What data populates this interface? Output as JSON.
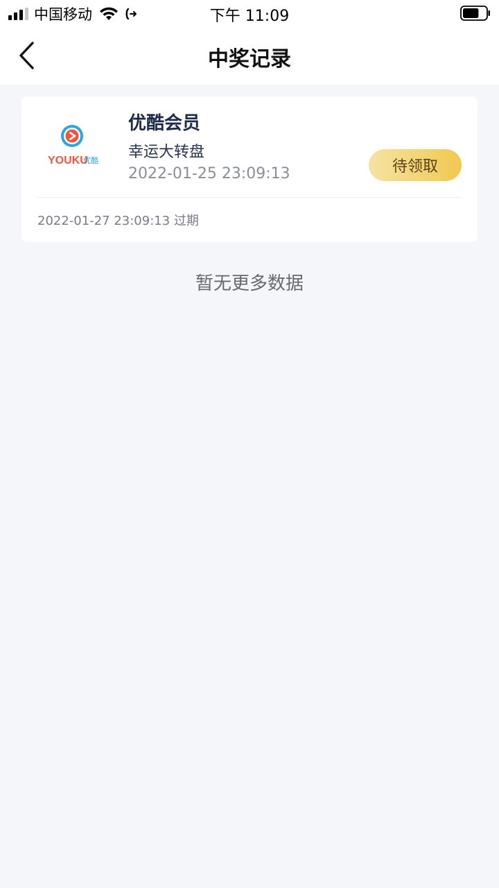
{
  "status_bar": {
    "carrier": "中国移动",
    "time": "下午 11:09",
    "signal_bars": 3,
    "signal_total": 4,
    "battery_level": 0.7
  },
  "header": {
    "title": "中奖记录",
    "back_icon": "chevron-left-icon"
  },
  "records": [
    {
      "logo_icon": "youku-logo",
      "logo_text_latin": "YOUKU",
      "logo_text_cn": "优酷",
      "prize_name": "优酷会员",
      "activity": "幸运大转盘",
      "win_time": "2022-01-25 23:09:13",
      "action_label": "待领取",
      "expire_text": "2022-01-27 23:09:13 过期"
    }
  ],
  "footer": {
    "no_more": "暂无更多数据"
  },
  "colors": {
    "background": "#f5f6fa",
    "button_gradient_start": "#f6e3a2",
    "button_gradient_end": "#f0c94f",
    "youku_blue": "#28a8e0",
    "youku_orange": "#f2543f"
  }
}
